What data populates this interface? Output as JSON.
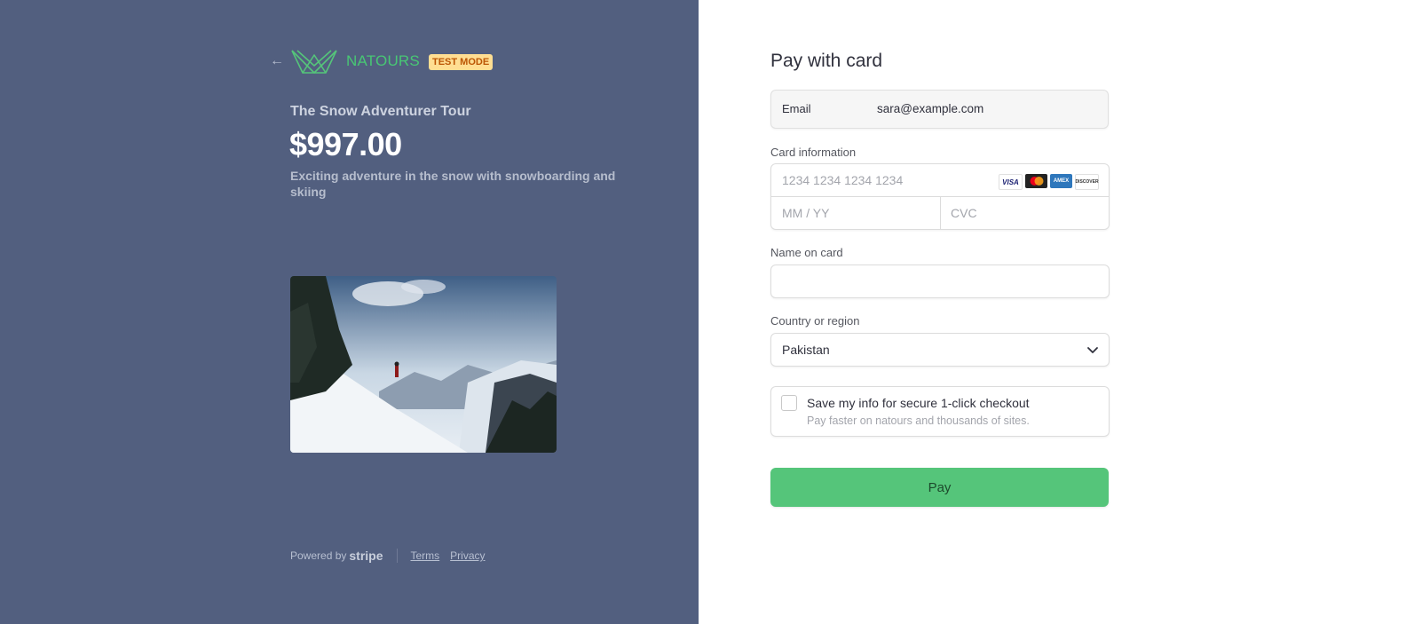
{
  "summary": {
    "back_icon": "arrow-left-icon",
    "brand_name": "NATOURS",
    "test_badge": "TEST MODE",
    "product_name": "The Snow Adventurer Tour",
    "price": "$997.00",
    "description": "Exciting adventure in the snow with snowboarding and skiing",
    "brand_color": "#55c57a"
  },
  "footer": {
    "powered_by": "Powered by",
    "stripe": "stripe",
    "terms": "Terms",
    "privacy": "Privacy"
  },
  "form": {
    "title": "Pay with card",
    "email_label": "Email",
    "email_value": "sara@example.com",
    "card_info_label": "Card information",
    "card_number_placeholder": "1234 1234 1234 1234",
    "expiry_placeholder": "MM / YY",
    "cvc_placeholder": "CVC",
    "card_brands": [
      "VISA",
      "mastercard",
      "amex",
      "DISCOVER"
    ],
    "name_label": "Name on card",
    "name_value": "",
    "country_label": "Country or region",
    "country_value": "Pakistan",
    "save_title": "Save my info for secure 1-click checkout",
    "save_subtitle": "Pay faster on natours and thousands of sites.",
    "save_checked": false,
    "pay_label": "Pay"
  }
}
